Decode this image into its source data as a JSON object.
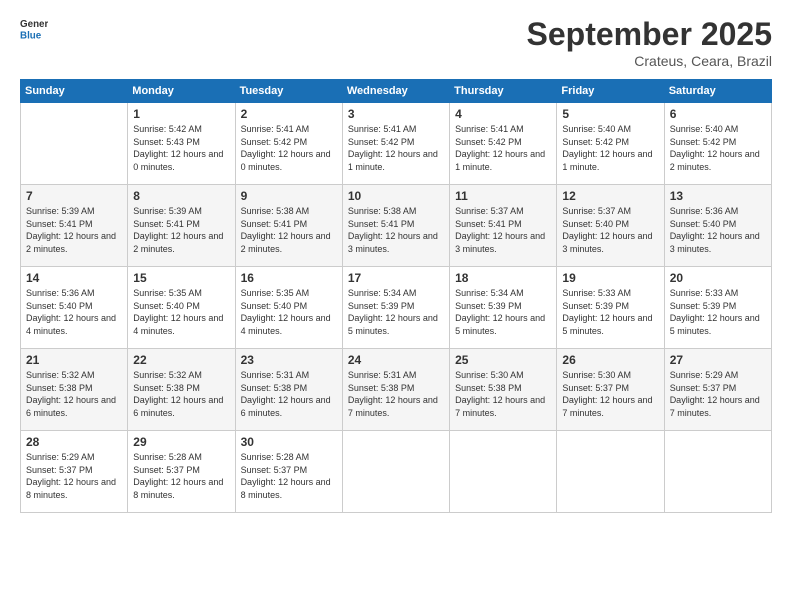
{
  "logo": {
    "line1": "General",
    "line2": "Blue"
  },
  "title": "September 2025",
  "subtitle": "Crateus, Ceara, Brazil",
  "days_header": [
    "Sunday",
    "Monday",
    "Tuesday",
    "Wednesday",
    "Thursday",
    "Friday",
    "Saturday"
  ],
  "weeks": [
    [
      {
        "day": "",
        "info": ""
      },
      {
        "day": "1",
        "info": "Sunrise: 5:42 AM\nSunset: 5:43 PM\nDaylight: 12 hours\nand 0 minutes."
      },
      {
        "day": "2",
        "info": "Sunrise: 5:41 AM\nSunset: 5:42 PM\nDaylight: 12 hours\nand 0 minutes."
      },
      {
        "day": "3",
        "info": "Sunrise: 5:41 AM\nSunset: 5:42 PM\nDaylight: 12 hours\nand 1 minute."
      },
      {
        "day": "4",
        "info": "Sunrise: 5:41 AM\nSunset: 5:42 PM\nDaylight: 12 hours\nand 1 minute."
      },
      {
        "day": "5",
        "info": "Sunrise: 5:40 AM\nSunset: 5:42 PM\nDaylight: 12 hours\nand 1 minute."
      },
      {
        "day": "6",
        "info": "Sunrise: 5:40 AM\nSunset: 5:42 PM\nDaylight: 12 hours\nand 2 minutes."
      }
    ],
    [
      {
        "day": "7",
        "info": "Sunrise: 5:39 AM\nSunset: 5:41 PM\nDaylight: 12 hours\nand 2 minutes."
      },
      {
        "day": "8",
        "info": "Sunrise: 5:39 AM\nSunset: 5:41 PM\nDaylight: 12 hours\nand 2 minutes."
      },
      {
        "day": "9",
        "info": "Sunrise: 5:38 AM\nSunset: 5:41 PM\nDaylight: 12 hours\nand 2 minutes."
      },
      {
        "day": "10",
        "info": "Sunrise: 5:38 AM\nSunset: 5:41 PM\nDaylight: 12 hours\nand 3 minutes."
      },
      {
        "day": "11",
        "info": "Sunrise: 5:37 AM\nSunset: 5:41 PM\nDaylight: 12 hours\nand 3 minutes."
      },
      {
        "day": "12",
        "info": "Sunrise: 5:37 AM\nSunset: 5:40 PM\nDaylight: 12 hours\nand 3 minutes."
      },
      {
        "day": "13",
        "info": "Sunrise: 5:36 AM\nSunset: 5:40 PM\nDaylight: 12 hours\nand 3 minutes."
      }
    ],
    [
      {
        "day": "14",
        "info": "Sunrise: 5:36 AM\nSunset: 5:40 PM\nDaylight: 12 hours\nand 4 minutes."
      },
      {
        "day": "15",
        "info": "Sunrise: 5:35 AM\nSunset: 5:40 PM\nDaylight: 12 hours\nand 4 minutes."
      },
      {
        "day": "16",
        "info": "Sunrise: 5:35 AM\nSunset: 5:40 PM\nDaylight: 12 hours\nand 4 minutes."
      },
      {
        "day": "17",
        "info": "Sunrise: 5:34 AM\nSunset: 5:39 PM\nDaylight: 12 hours\nand 5 minutes."
      },
      {
        "day": "18",
        "info": "Sunrise: 5:34 AM\nSunset: 5:39 PM\nDaylight: 12 hours\nand 5 minutes."
      },
      {
        "day": "19",
        "info": "Sunrise: 5:33 AM\nSunset: 5:39 PM\nDaylight: 12 hours\nand 5 minutes."
      },
      {
        "day": "20",
        "info": "Sunrise: 5:33 AM\nSunset: 5:39 PM\nDaylight: 12 hours\nand 5 minutes."
      }
    ],
    [
      {
        "day": "21",
        "info": "Sunrise: 5:32 AM\nSunset: 5:38 PM\nDaylight: 12 hours\nand 6 minutes."
      },
      {
        "day": "22",
        "info": "Sunrise: 5:32 AM\nSunset: 5:38 PM\nDaylight: 12 hours\nand 6 minutes."
      },
      {
        "day": "23",
        "info": "Sunrise: 5:31 AM\nSunset: 5:38 PM\nDaylight: 12 hours\nand 6 minutes."
      },
      {
        "day": "24",
        "info": "Sunrise: 5:31 AM\nSunset: 5:38 PM\nDaylight: 12 hours\nand 7 minutes."
      },
      {
        "day": "25",
        "info": "Sunrise: 5:30 AM\nSunset: 5:38 PM\nDaylight: 12 hours\nand 7 minutes."
      },
      {
        "day": "26",
        "info": "Sunrise: 5:30 AM\nSunset: 5:37 PM\nDaylight: 12 hours\nand 7 minutes."
      },
      {
        "day": "27",
        "info": "Sunrise: 5:29 AM\nSunset: 5:37 PM\nDaylight: 12 hours\nand 7 minutes."
      }
    ],
    [
      {
        "day": "28",
        "info": "Sunrise: 5:29 AM\nSunset: 5:37 PM\nDaylight: 12 hours\nand 8 minutes."
      },
      {
        "day": "29",
        "info": "Sunrise: 5:28 AM\nSunset: 5:37 PM\nDaylight: 12 hours\nand 8 minutes."
      },
      {
        "day": "30",
        "info": "Sunrise: 5:28 AM\nSunset: 5:37 PM\nDaylight: 12 hours\nand 8 minutes."
      },
      {
        "day": "",
        "info": ""
      },
      {
        "day": "",
        "info": ""
      },
      {
        "day": "",
        "info": ""
      },
      {
        "day": "",
        "info": ""
      }
    ]
  ]
}
